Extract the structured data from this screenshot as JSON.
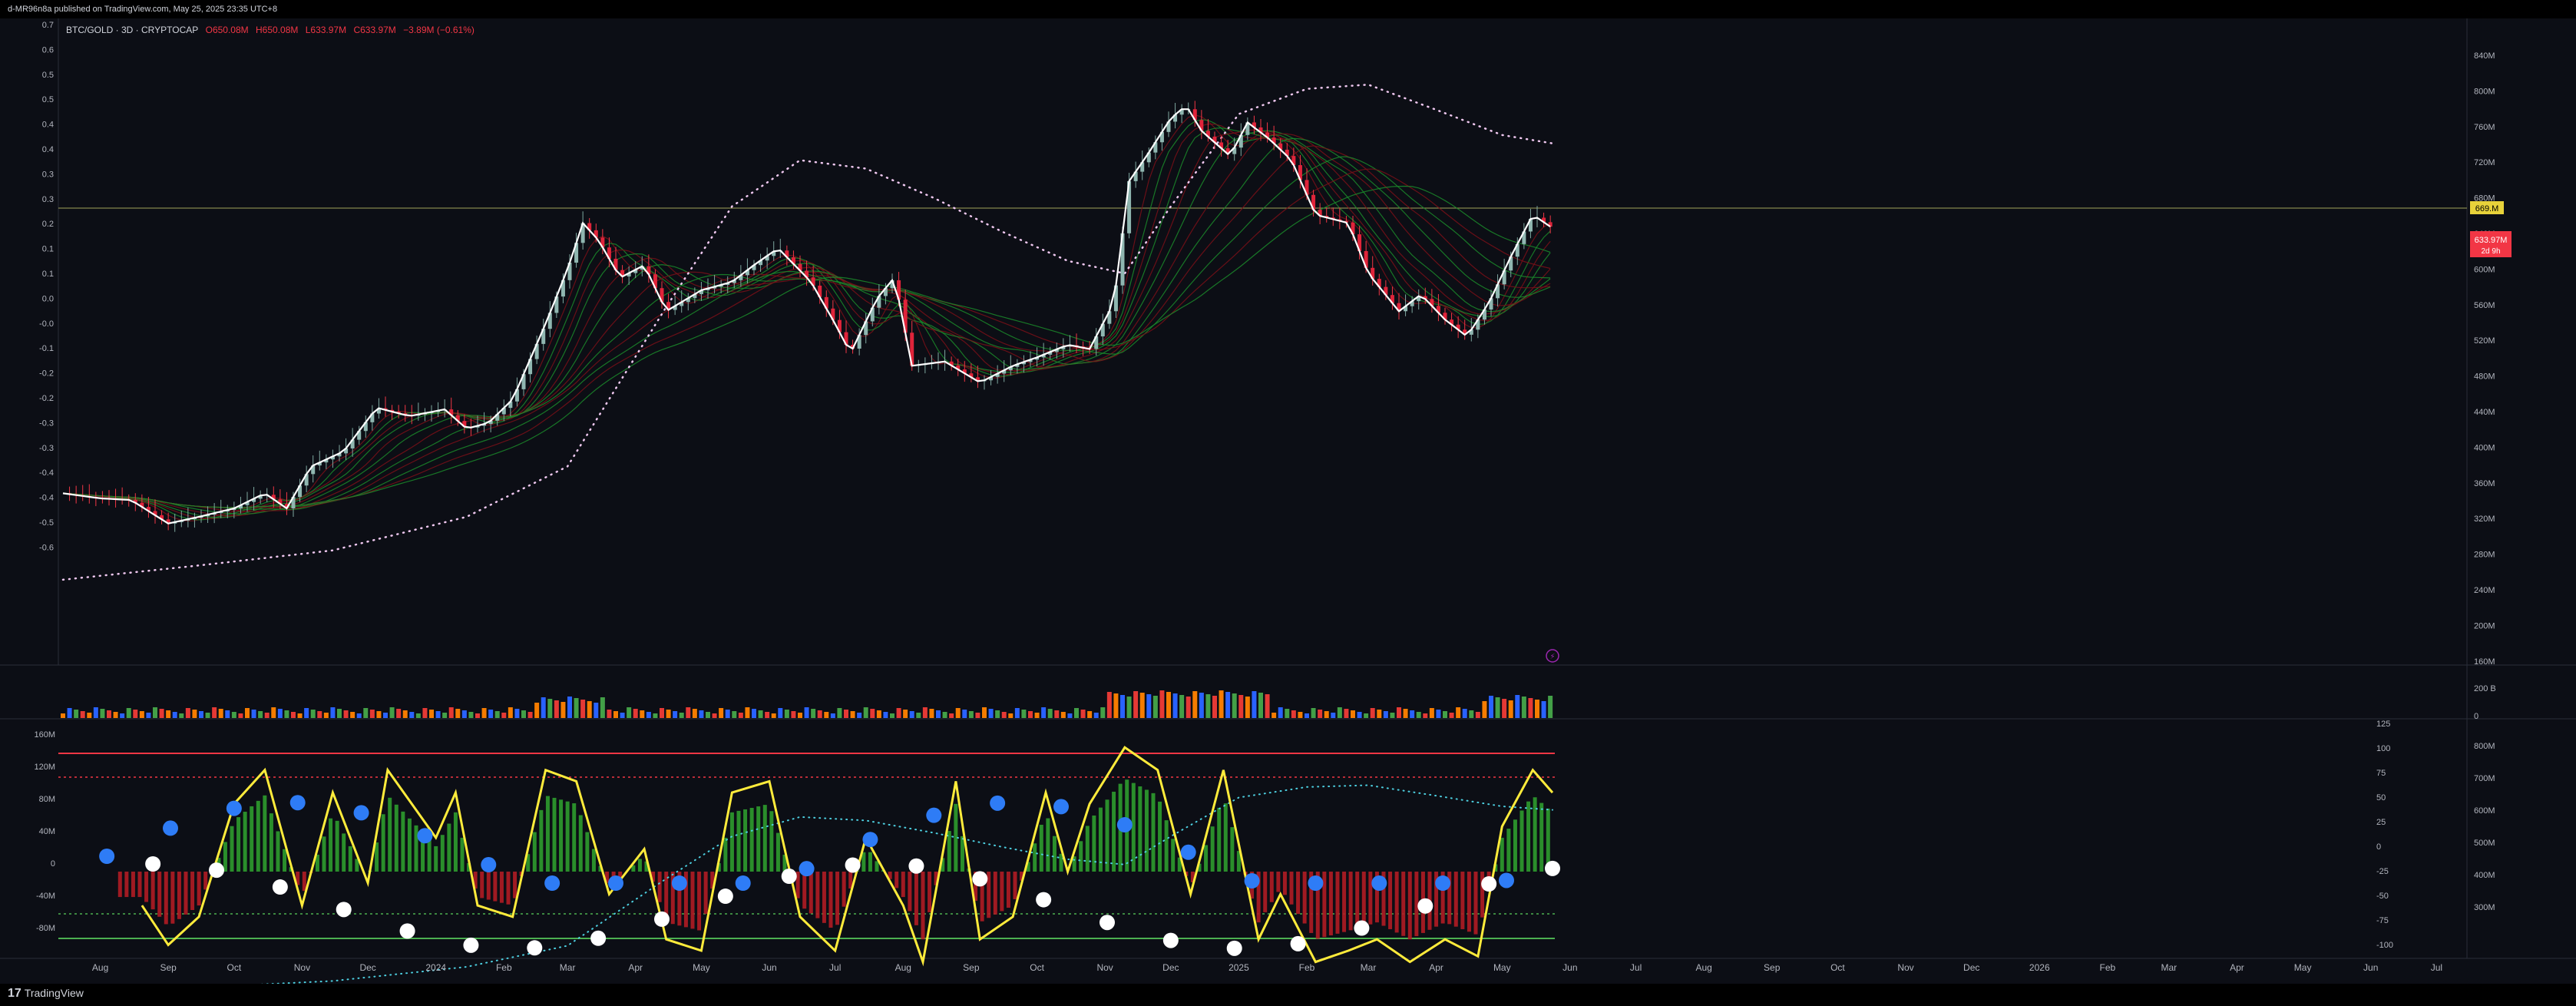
{
  "header": {
    "publisher": "d-MR96n8a published on TradingView.com, May 25, 2025 23:35 UTC+8"
  },
  "symbol": {
    "name": "BTC/GOLD · 3D · CRYPTOCAP",
    "o": "O650.08M",
    "h": "H650.08M",
    "l": "L633.97M",
    "c": "C633.97M",
    "chg": "−3.89M (−0.61%)"
  },
  "price_axis": {
    "labels": [
      "840M",
      "800M",
      "760M",
      "720M",
      "680M",
      "640M",
      "600M",
      "560M",
      "520M",
      "480M",
      "440M",
      "400M",
      "360M",
      "320M",
      "280M",
      "240M",
      "200M",
      "160M"
    ]
  },
  "left_axis": {
    "labels": [
      "0.7",
      "0.6",
      "0.5",
      "0.5",
      "0.4",
      "0.4",
      "0.3",
      "0.3",
      "0.2",
      "0.1",
      "0.1",
      "0.0",
      "-0.0",
      "-0.1",
      "-0.2",
      "-0.2",
      "-0.3",
      "-0.3",
      "-0.4",
      "-0.4",
      "-0.5",
      "-0.6"
    ]
  },
  "badges": {
    "line_price": "669.M",
    "last_price": "633.97M",
    "countdown": "2d 9h"
  },
  "volume_axis": {
    "labels": [
      "200 B",
      "0"
    ]
  },
  "osc_left_axis": {
    "labels": [
      "160M",
      "120M",
      "80M",
      "40M",
      "0",
      "-40M",
      "-80M"
    ]
  },
  "osc_mid_axis": {
    "labels": [
      "125",
      "100",
      "75",
      "50",
      "25",
      "0",
      "-25",
      "-50",
      "-75",
      "-100"
    ]
  },
  "osc_right_axis": {
    "labels": [
      "800M",
      "700M",
      "600M",
      "500M",
      "400M",
      "300M"
    ]
  },
  "time_axis": {
    "labels": [
      "Aug",
      "Sep",
      "Oct",
      "Nov",
      "Dec",
      "2024",
      "Feb",
      "Mar",
      "Apr",
      "May",
      "Jun",
      "Jul",
      "Aug",
      "Sep",
      "Oct",
      "Nov",
      "Dec",
      "2025",
      "Feb",
      "Mar",
      "Apr",
      "May",
      "Jun",
      "Jul",
      "Aug",
      "Sep",
      "Oct",
      "Nov",
      "Dec",
      "2026",
      "Feb",
      "Mar",
      "Apr",
      "May",
      "Jun",
      "Jul"
    ]
  },
  "footer": {
    "brand": "TradingView"
  },
  "colors": {
    "bg": "#0c0e15",
    "up": "#26a69a",
    "down": "#f23645",
    "price_line": "#ffffff",
    "osc_line": "#ffeb3b",
    "dots_blue": "#2e7cf6"
  },
  "chart_data": {
    "type": "line",
    "title": "BTC/GOLD · 3D · CRYPTOCAP",
    "ylabel": "",
    "ylim": [
      160,
      860
    ],
    "price_path": [
      [
        "2023-07-15",
        318
      ],
      [
        "2023-08-01",
        312
      ],
      [
        "2023-08-15",
        310
      ],
      [
        "2023-09-01",
        282
      ],
      [
        "2023-09-15",
        290
      ],
      [
        "2023-10-01",
        300
      ],
      [
        "2023-10-15",
        318
      ],
      [
        "2023-10-25",
        300
      ],
      [
        "2023-11-05",
        350
      ],
      [
        "2023-11-20",
        368
      ],
      [
        "2023-12-05",
        420
      ],
      [
        "2023-12-20",
        410
      ],
      [
        "2024-01-05",
        418
      ],
      [
        "2024-01-15",
        395
      ],
      [
        "2024-01-25",
        402
      ],
      [
        "2024-02-05",
        430
      ],
      [
        "2024-02-20",
        520
      ],
      [
        "2024-03-01",
        585
      ],
      [
        "2024-03-08",
        640
      ],
      [
        "2024-03-15",
        620
      ],
      [
        "2024-03-25",
        575
      ],
      [
        "2024-04-05",
        590
      ],
      [
        "2024-04-15",
        535
      ],
      [
        "2024-05-01",
        560
      ],
      [
        "2024-05-15",
        570
      ],
      [
        "2024-05-25",
        590
      ],
      [
        "2024-06-05",
        610
      ],
      [
        "2024-06-20",
        570
      ],
      [
        "2024-07-01",
        520
      ],
      [
        "2024-07-08",
        485
      ],
      [
        "2024-07-20",
        550
      ],
      [
        "2024-07-28",
        575
      ],
      [
        "2024-08-05",
        470
      ],
      [
        "2024-08-20",
        475
      ],
      [
        "2024-09-05",
        450
      ],
      [
        "2024-09-20",
        470
      ],
      [
        "2024-10-01",
        480
      ],
      [
        "2024-10-15",
        495
      ],
      [
        "2024-10-25",
        490
      ],
      [
        "2024-11-05",
        545
      ],
      [
        "2024-11-12",
        690
      ],
      [
        "2024-11-20",
        720
      ],
      [
        "2024-12-01",
        765
      ],
      [
        "2024-12-08",
        780
      ],
      [
        "2024-12-15",
        750
      ],
      [
        "2024-12-28",
        720
      ],
      [
        "2025-01-05",
        760
      ],
      [
        "2025-01-15",
        740
      ],
      [
        "2025-01-25",
        715
      ],
      [
        "2025-02-05",
        650
      ],
      [
        "2025-02-20",
        640
      ],
      [
        "2025-03-01",
        580
      ],
      [
        "2025-03-15",
        535
      ],
      [
        "2025-03-25",
        555
      ],
      [
        "2025-04-05",
        525
      ],
      [
        "2025-04-15",
        505
      ],
      [
        "2025-04-25",
        545
      ],
      [
        "2025-05-05",
        600
      ],
      [
        "2025-05-15",
        650
      ],
      [
        "2025-05-24",
        634
      ]
    ],
    "slow_ma_dotted": [
      [
        "2023-07-15",
        215
      ],
      [
        "2023-09-15",
        232
      ],
      [
        "2023-11-15",
        250
      ],
      [
        "2024-01-15",
        290
      ],
      [
        "2024-03-01",
        350
      ],
      [
        "2024-04-15",
        540
      ],
      [
        "2024-05-15",
        660
      ],
      [
        "2024-06-15",
        715
      ],
      [
        "2024-07-15",
        705
      ],
      [
        "2024-08-15",
        670
      ],
      [
        "2024-09-15",
        630
      ],
      [
        "2024-10-15",
        595
      ],
      [
        "2024-11-10",
        580
      ],
      [
        "2024-12-01",
        660
      ],
      [
        "2025-01-01",
        770
      ],
      [
        "2025-02-01",
        800
      ],
      [
        "2025-03-01",
        805
      ],
      [
        "2025-04-01",
        775
      ],
      [
        "2025-05-01",
        745
      ],
      [
        "2025-05-24",
        735
      ]
    ],
    "series": [
      {
        "name": "",
        "values": [
          [
            "2023-08-20",
            -30
          ],
          [
            "2023-09-01",
            -65
          ],
          [
            "2023-09-15",
            -40
          ],
          [
            "2023-10-01",
            60
          ],
          [
            "2023-10-15",
            90
          ],
          [
            "2023-11-01",
            -30
          ],
          [
            "2023-11-15",
            70
          ],
          [
            "2023-12-01",
            -10
          ],
          [
            "2023-12-10",
            90
          ],
          [
            "2024-01-01",
            30
          ],
          [
            "2024-01-10",
            70
          ],
          [
            "2024-01-20",
            -30
          ],
          [
            "2024-02-05",
            -40
          ],
          [
            "2024-02-20",
            90
          ],
          [
            "2024-03-05",
            80
          ],
          [
            "2024-03-20",
            -20
          ],
          [
            "2024-04-05",
            20
          ],
          [
            "2024-04-15",
            -60
          ],
          [
            "2024-05-01",
            -70
          ],
          [
            "2024-05-15",
            70
          ],
          [
            "2024-06-01",
            80
          ],
          [
            "2024-06-15",
            -40
          ],
          [
            "2024-07-01",
            -70
          ],
          [
            "2024-07-15",
            30
          ],
          [
            "2024-08-01",
            -30
          ],
          [
            "2024-08-10",
            -80
          ],
          [
            "2024-08-25",
            80
          ],
          [
            "2024-09-05",
            -60
          ],
          [
            "2024-09-20",
            -40
          ],
          [
            "2024-10-05",
            70
          ],
          [
            "2024-10-15",
            0
          ],
          [
            "2024-10-25",
            60
          ],
          [
            "2024-11-10",
            110
          ],
          [
            "2024-11-25",
            90
          ],
          [
            "2024-12-10",
            -20
          ],
          [
            "2024-12-25",
            90
          ],
          [
            "2025-01-10",
            -60
          ],
          [
            "2025-01-20",
            -20
          ],
          [
            "2025-02-05",
            -80
          ],
          [
            "2025-02-20",
            -70
          ],
          [
            "2025-03-05",
            -60
          ],
          [
            "2025-03-20",
            -80
          ],
          [
            "2025-04-05",
            -60
          ],
          [
            "2025-04-20",
            -75
          ],
          [
            "2025-05-01",
            40
          ],
          [
            "2025-05-15",
            90
          ],
          [
            "2025-05-24",
            70
          ]
        ]
      }
    ]
  }
}
